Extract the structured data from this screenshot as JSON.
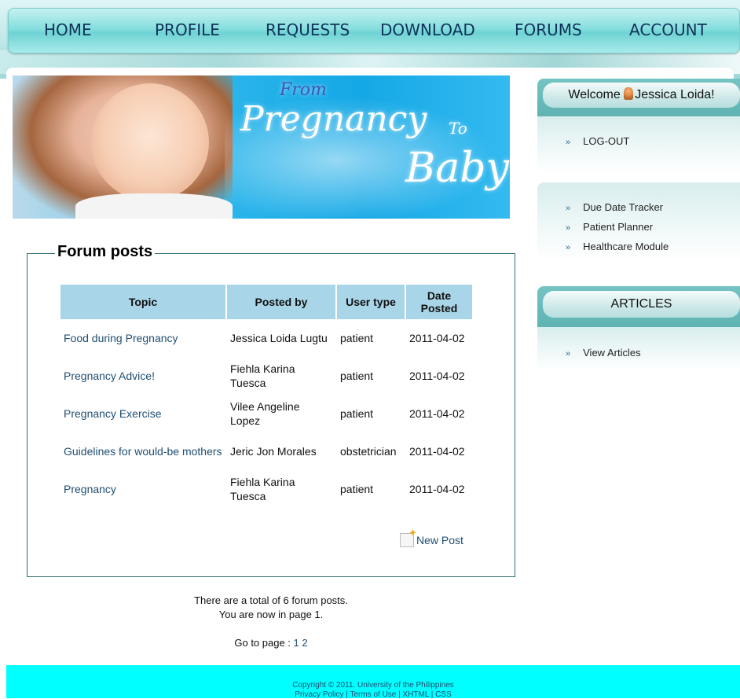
{
  "nav": {
    "items": [
      "HOME",
      "PROFILE",
      "REQUESTS",
      "DOWNLOAD",
      "FORUMS",
      "ACCOUNT"
    ]
  },
  "banner": {
    "from": "From",
    "pregnancy": "Pregnancy",
    "to": "To",
    "baby": "Baby"
  },
  "forum": {
    "legend": "Forum posts",
    "headers": [
      "Topic",
      "Posted by",
      "User type",
      "Date Posted"
    ],
    "rows": [
      {
        "topic": "Food during Pregnancy",
        "posted_by": "Jessica Loida Lugtu",
        "user_type": "patient",
        "date": "2011-04-02"
      },
      {
        "topic": "Pregnancy Advice!",
        "posted_by": "Fiehla Karina Tuesca",
        "user_type": "patient",
        "date": "2011-04-02"
      },
      {
        "topic": "Pregnancy Exercise",
        "posted_by": "Vilee Angeline Lopez",
        "user_type": "patient",
        "date": "2011-04-02"
      },
      {
        "topic": "Guidelines for would-be mothers",
        "posted_by": "Jeric Jon Morales",
        "user_type": "obstetrician",
        "date": "2011-04-02"
      },
      {
        "topic": "Pregnancy",
        "posted_by": "Fiehla Karina Tuesca",
        "user_type": "patient",
        "date": "2011-04-02"
      }
    ],
    "new_post": "New Post",
    "total_text": "There are a total of 6 forum posts.",
    "page_text": "You are now in page 1.",
    "goto_label": "Go to page :",
    "pages": [
      "1",
      "2"
    ]
  },
  "sidebar": {
    "welcome_prefix": "Welcome",
    "user_name": "Jessica Loida!",
    "logout": "LOG-OUT",
    "tools": [
      "Due Date Tracker",
      "Patient Planner",
      "Healthcare Module"
    ],
    "articles_title": "ARTICLES",
    "view_articles": "View Articles"
  },
  "footer": {
    "copyright": "Copyright © 2011. University of the Philippines",
    "links": "Privacy Policy | Terms of Use | XHTML | CSS"
  }
}
